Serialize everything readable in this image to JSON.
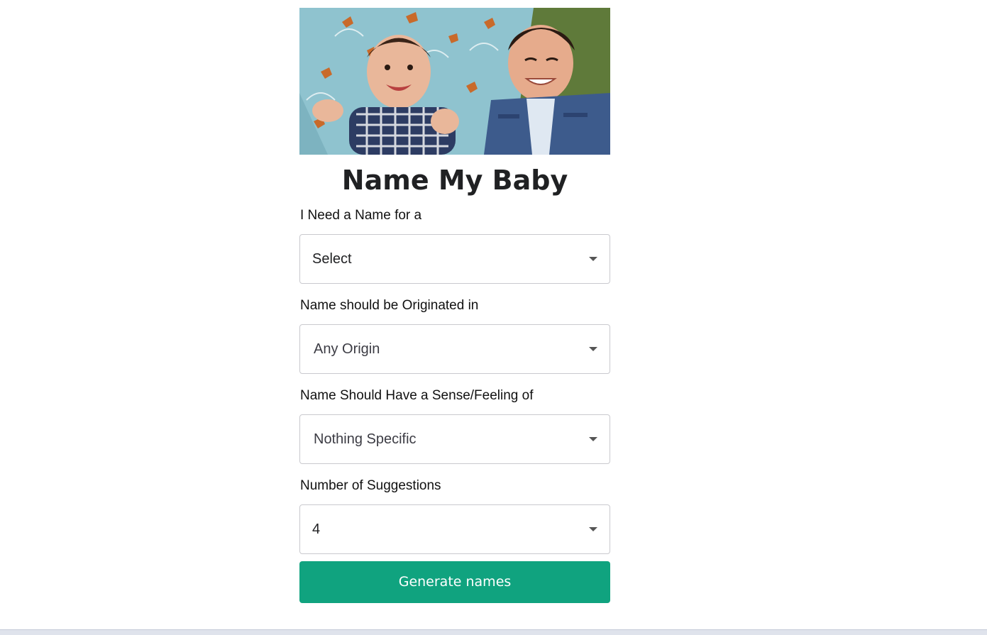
{
  "app": {
    "title": "Name My Baby"
  },
  "hero": {
    "alt": "Two smiling baby boys lying on a blanket"
  },
  "form": {
    "gender": {
      "label": "I Need a Name for a",
      "value": "Select"
    },
    "origin": {
      "label": "Name should be Originated in",
      "value": "Any Origin"
    },
    "meaning": {
      "label": "Name Should Have a Sense/Feeling of",
      "value": "Nothing Specific"
    },
    "count": {
      "label": "Number of Suggestions",
      "value": "4"
    },
    "submit_label": "Generate names"
  },
  "colors": {
    "accent": "#10a37f",
    "border": "#c9c9ce",
    "text": "#202123"
  }
}
